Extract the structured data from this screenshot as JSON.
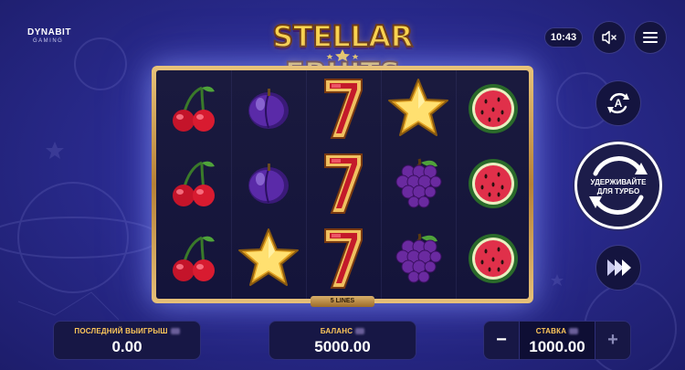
{
  "brand": {
    "name": "DYNABIT",
    "sub": "GAMING"
  },
  "game": {
    "title": "STELLAR FRUITS"
  },
  "clock": "10:43",
  "icons": {
    "sound": "speaker-muted-icon",
    "menu": "hamburger-menu-icon",
    "autoplay": "autoplay-icon",
    "turbo": "turbo-spin-icon",
    "skip": "fast-forward-icon"
  },
  "reels": {
    "lines_label": "5 LINES",
    "grid": [
      [
        "cherry",
        "plum",
        "seven",
        "star",
        "watermelon"
      ],
      [
        "cherry",
        "plum",
        "seven",
        "grapes",
        "watermelon"
      ],
      [
        "cherry",
        "star",
        "seven",
        "grapes",
        "watermelon"
      ]
    ]
  },
  "turbo": {
    "line1": "УДЕРЖИВАЙТЕ",
    "line2": "ДЛЯ ТУРБО"
  },
  "panels": {
    "last_win": {
      "label": "ПОСЛЕДНИЙ ВЫИГРЫШ",
      "value": "0.00"
    },
    "balance": {
      "label": "БАЛАНС",
      "value": "5000.00"
    },
    "stake": {
      "label": "СТАВКА",
      "value": "1000.00",
      "minus": "−",
      "plus": "+"
    }
  },
  "colors": {
    "accent": "#ffc85a",
    "background": "#2a2b8f",
    "frame_gold": "#e8c37a"
  }
}
